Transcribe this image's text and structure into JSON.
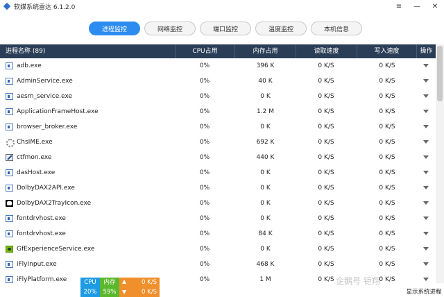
{
  "app": {
    "title": "软媒系统雷达 6.1.2.0",
    "window_buttons": [
      "≡",
      "—",
      "✕"
    ]
  },
  "tabs": [
    {
      "label": "进程监控",
      "active": true
    },
    {
      "label": "网络监控",
      "active": false
    },
    {
      "label": "端口监控",
      "active": false
    },
    {
      "label": "温度监控",
      "active": false
    },
    {
      "label": "本机信息",
      "active": false
    }
  ],
  "table": {
    "headers": {
      "name": "进程名称 (89)",
      "cpu": "CPU占用",
      "mem": "内存占用",
      "read": "读取速度",
      "write": "写入速度",
      "op": "操作"
    },
    "rows": [
      {
        "name": "adb.exe",
        "icon": "window-icon",
        "cpu": "0%",
        "mem": "396 K",
        "read": "0 K/S",
        "write": "0 K/S"
      },
      {
        "name": "AdminService.exe",
        "icon": "window-icon",
        "cpu": "0%",
        "mem": "40 K",
        "read": "0 K/S",
        "write": "0 K/S"
      },
      {
        "name": "aesm_service.exe",
        "icon": "window-icon",
        "cpu": "0%",
        "mem": "0 K",
        "read": "0 K/S",
        "write": "0 K/S"
      },
      {
        "name": "ApplicationFrameHost.exe",
        "icon": "window-icon",
        "cpu": "0%",
        "mem": "1.2 M",
        "read": "0 K/S",
        "write": "0 K/S"
      },
      {
        "name": "browser_broker.exe",
        "icon": "window-icon",
        "cpu": "0%",
        "mem": "0 K",
        "read": "0 K/S",
        "write": "0 K/S"
      },
      {
        "name": "ChsIME.exe",
        "icon": "gear-icon",
        "cpu": "0%",
        "mem": "692 K",
        "read": "0 K/S",
        "write": "0 K/S"
      },
      {
        "name": "ctfmon.exe",
        "icon": "pen-icon",
        "cpu": "0%",
        "mem": "440 K",
        "read": "0 K/S",
        "write": "0 K/S"
      },
      {
        "name": "dasHost.exe",
        "icon": "window-icon",
        "cpu": "0%",
        "mem": "0 K",
        "read": "0 K/S",
        "write": "0 K/S"
      },
      {
        "name": "DolbyDAX2API.exe",
        "icon": "window-icon",
        "cpu": "0%",
        "mem": "0 K",
        "read": "0 K/S",
        "write": "0 K/S"
      },
      {
        "name": "DolbyDAX2TrayIcon.exe",
        "icon": "dolby-icon",
        "cpu": "0%",
        "mem": "0 K",
        "read": "0 K/S",
        "write": "0 K/S"
      },
      {
        "name": "fontdrvhost.exe",
        "icon": "window-icon",
        "cpu": "0%",
        "mem": "0 K",
        "read": "0 K/S",
        "write": "0 K/S"
      },
      {
        "name": "fontdrvhost.exe",
        "icon": "window-icon",
        "cpu": "0%",
        "mem": "84 K",
        "read": "0 K/S",
        "write": "0 K/S"
      },
      {
        "name": "GfExperienceService.exe",
        "icon": "nvidia-icon",
        "cpu": "0%",
        "mem": "0 K",
        "read": "0 K/S",
        "write": "0 K/S"
      },
      {
        "name": "iFlyInput.exe",
        "icon": "window-icon",
        "cpu": "0%",
        "mem": "468 K",
        "read": "0 K/S",
        "write": "0 K/S"
      },
      {
        "name": "iFlyPlatform.exe",
        "icon": "window-icon",
        "cpu": "0%",
        "mem": "1 M",
        "read": "0 K/S",
        "write": "0 K/S"
      }
    ]
  },
  "monitor": {
    "cpu_label": "CPU",
    "cpu_value": "20%",
    "mem_label": "内存",
    "mem_value": "59%",
    "up_value": "0 K/S",
    "down_value": "0 K/S"
  },
  "footer": {
    "show_system": "显示系统进程",
    "watermark": "企鹅号 钜翔"
  },
  "colors": {
    "accent": "#2d8cf0",
    "header_bg": "#2b3e57",
    "cpu_badge": "#1e9be3",
    "mem_badge": "#5bb82d",
    "net_badge": "#f0902c"
  }
}
